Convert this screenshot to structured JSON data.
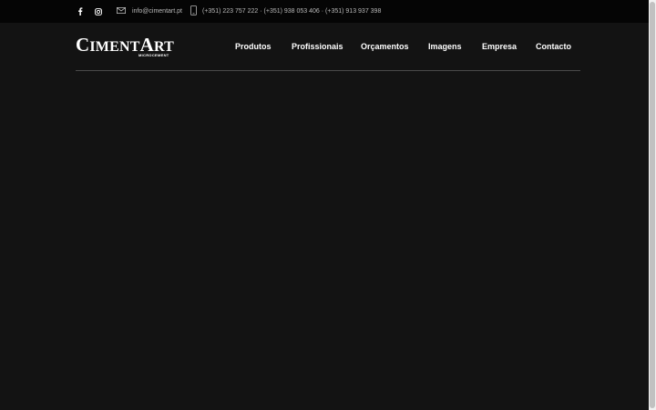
{
  "topbar": {
    "social": [
      {
        "name": "facebook-icon"
      },
      {
        "name": "instagram-icon"
      }
    ],
    "email": "info@cimentart.pt",
    "phones": "(+351) 223 757 222 · (+351) 938 053 406 · (+351) 913 937 398"
  },
  "logo": {
    "brand_first_cap": "C",
    "brand_first_rest": "IMENT",
    "brand_second_cap": "A",
    "brand_second_rest": "RT",
    "tagline": "MICROCEMENT"
  },
  "nav": {
    "items": [
      {
        "label": "Produtos"
      },
      {
        "label": "Profissionais"
      },
      {
        "label": "Orçamentos"
      },
      {
        "label": "Imagens"
      },
      {
        "label": "Empresa"
      },
      {
        "label": "Contacto"
      }
    ]
  },
  "colors": {
    "background": "#131313",
    "topbar": "#050505",
    "text": "#ffffff",
    "muted_text": "#b9b9b9",
    "divider": "#4a4a4a"
  }
}
